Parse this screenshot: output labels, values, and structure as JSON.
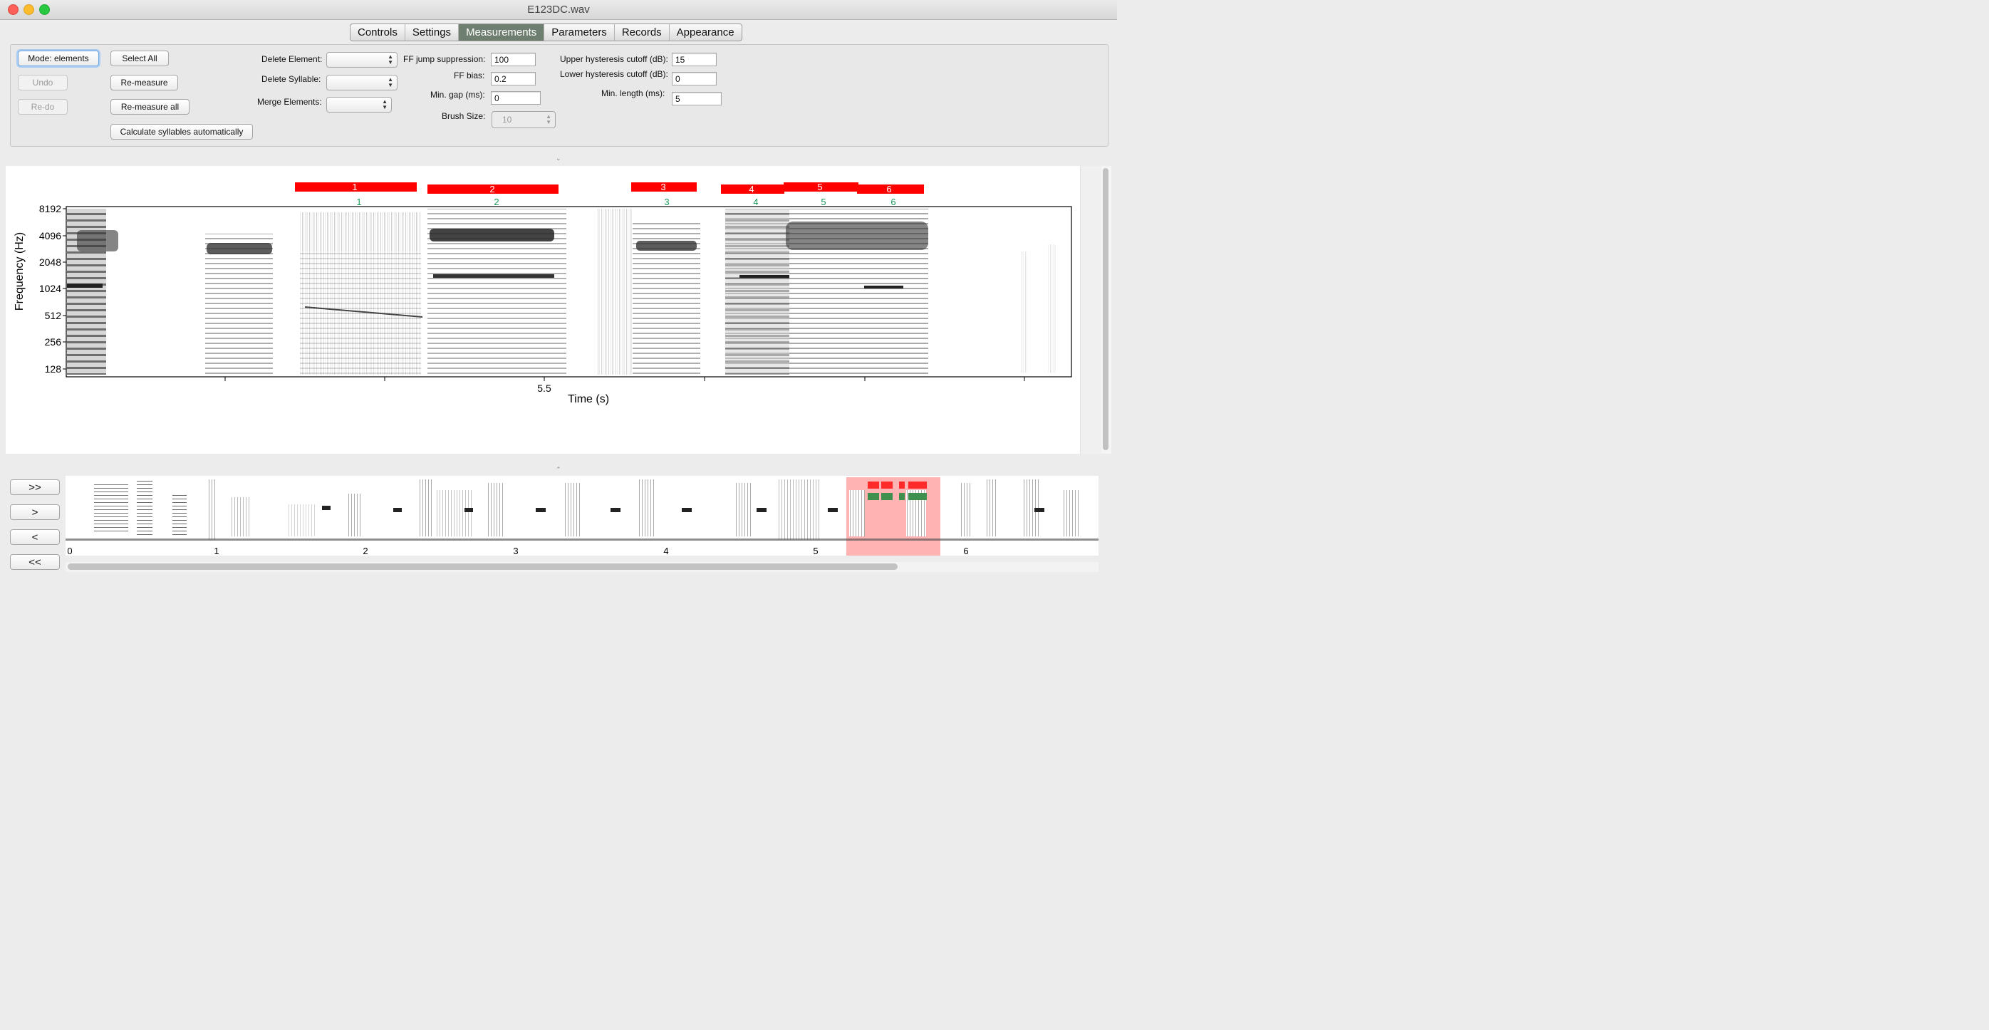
{
  "window": {
    "title": "E123DC.wav"
  },
  "tabs": [
    {
      "label": "Controls",
      "active": false
    },
    {
      "label": "Settings",
      "active": false
    },
    {
      "label": "Measurements",
      "active": true
    },
    {
      "label": "Parameters",
      "active": false
    },
    {
      "label": "Records",
      "active": false
    },
    {
      "label": "Appearance",
      "active": false
    }
  ],
  "controls": {
    "mode_button": "Mode: elements",
    "select_all": "Select All",
    "undo": "Undo",
    "remeasure": "Re-measure",
    "redo": "Re-do",
    "remeasure_all": "Re-measure all",
    "calc_syllables": "Calculate syllables automatically",
    "delete_element_label": "Delete Element:",
    "delete_syllable_label": "Delete Syllable:",
    "merge_elements_label": "Merge Elements:",
    "delete_element_value": "",
    "delete_syllable_value": "",
    "merge_elements_value": ""
  },
  "params": {
    "ff_jump_label": "FF jump suppression:",
    "ff_jump_value": "100",
    "ff_bias_label": "FF bias:",
    "ff_bias_value": "0.2",
    "min_gap_label": "Min. gap (ms):",
    "min_gap_value": "0",
    "brush_label": "Brush Size:",
    "brush_value": "10",
    "upper_label": "Upper hysteresis cutoff (dB):",
    "upper_value": "15",
    "lower_label": "Lower hysteresis cutoff (dB):",
    "lower_value": "0",
    "minlen_label": "Min. length (ms):",
    "minlen_value": "5"
  },
  "spectrogram": {
    "y_axis_label": "Frequency (Hz)",
    "x_axis_label": "Time (s)",
    "y_ticks": [
      "8192",
      "4096",
      "2048",
      "1024",
      "512",
      "256",
      "128"
    ],
    "x_tick_label": "5.5",
    "colors": {
      "element_bar": "#ff0000",
      "syllable_label": "#1a9a5a"
    },
    "elements": [
      {
        "id": "1",
        "syl": "1"
      },
      {
        "id": "2",
        "syl": "2"
      },
      {
        "id": "3",
        "syl": "3"
      },
      {
        "id": "4",
        "syl": "4"
      },
      {
        "id": "5",
        "syl": "5"
      },
      {
        "id": "6",
        "syl": "6"
      }
    ]
  },
  "navigation": {
    "fast_forward": ">>",
    "forward": ">",
    "back": "<",
    "fast_back": "<<"
  },
  "overview": {
    "x_ticks": [
      "0",
      "1",
      "2",
      "3",
      "4",
      "5",
      "6"
    ],
    "selection_color": "#ffb3b3"
  }
}
